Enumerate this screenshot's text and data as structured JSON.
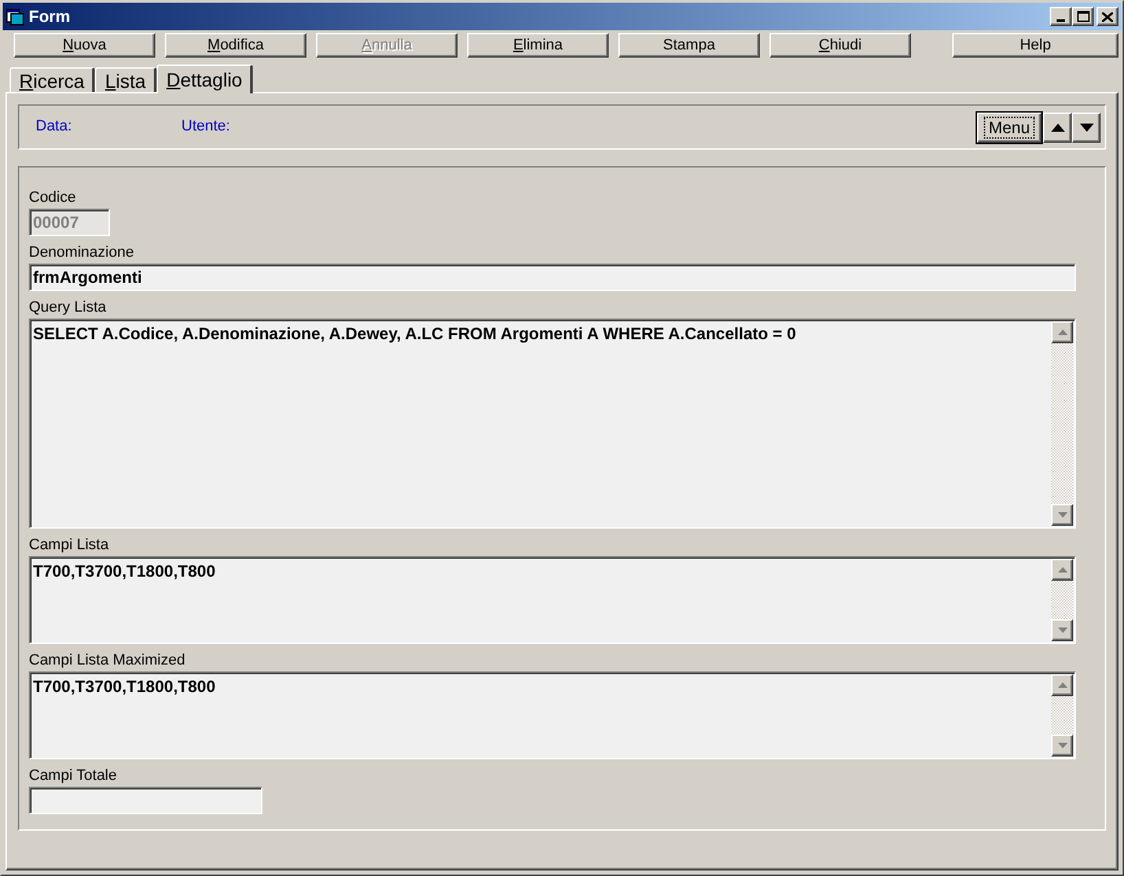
{
  "window": {
    "title": "Form"
  },
  "toolbar": [
    {
      "label": "Nuova",
      "mnemonic": true,
      "disabled": false
    },
    {
      "label": "Modifica",
      "mnemonic": true,
      "disabled": false
    },
    {
      "label": "Annulla",
      "mnemonic": true,
      "disabled": true
    },
    {
      "label": "Elimina",
      "mnemonic": true,
      "disabled": false
    },
    {
      "label": "Stampa",
      "mnemonic": false,
      "disabled": false
    },
    {
      "label": "Chiudi",
      "mnemonic": true,
      "disabled": false
    }
  ],
  "help_button": {
    "label": "Help"
  },
  "tabs": [
    {
      "label": "Ricerca",
      "selected": false
    },
    {
      "label": "Lista",
      "selected": false
    },
    {
      "label": "Dettaglio",
      "selected": true
    }
  ],
  "header": {
    "data_label": "Data:",
    "utente_label": "Utente:",
    "menu_button": "Menu"
  },
  "fields": [
    {
      "label": "Codice",
      "value": "00007",
      "kind": "short",
      "disabled": true
    },
    {
      "label": "Denominazione",
      "value": "frmArgomenti",
      "kind": "line",
      "disabled": false
    },
    {
      "label": "Query Lista",
      "value": "SELECT A.Codice, A.Denominazione, A.Dewey, A.LC FROM Argomenti A WHERE A.Cancellato = 0",
      "kind": "memo_tall",
      "disabled": false
    },
    {
      "label": "Campi Lista",
      "value": "T700,T3700,T1800,T800",
      "kind": "memo",
      "disabled": false
    },
    {
      "label": "Campi Lista Maximized",
      "value": "T700,T3700,T1800,T800",
      "kind": "memo",
      "disabled": false
    },
    {
      "label": "Campi Totale",
      "kind": "medium",
      "disabled": false
    }
  ]
}
